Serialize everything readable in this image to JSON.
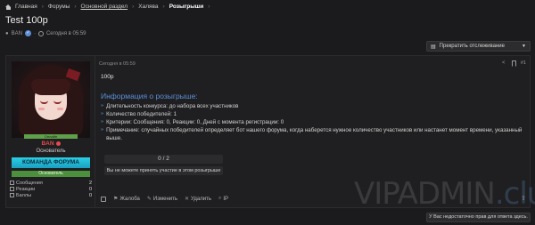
{
  "breadcrumb": {
    "items": [
      "Главная",
      "Форумы",
      "Основной раздел",
      "Халява",
      "Розыгрыши"
    ]
  },
  "thread": {
    "title": "Test 100р",
    "author": "BAN",
    "time": "Сегодня в 05:59"
  },
  "follow_button": {
    "label": "Прекратить отслеживание"
  },
  "user": {
    "name": "BAN",
    "status_bar": "Онлайн",
    "role": "Основатель",
    "banner": "КОМАНДА ФОРУМА",
    "badge": "Основатель",
    "stats": [
      {
        "label": "Сообщения",
        "value": "2"
      },
      {
        "label": "Реакции",
        "value": "0"
      },
      {
        "label": "Баллы",
        "value": "0"
      }
    ]
  },
  "post": {
    "time": "Сегодня в 05:59",
    "number": "#1",
    "message": "100р",
    "info_heading": "Информация о розыгрыше:",
    "info_items": [
      "Длительность конкурса: до набора всех участников",
      "Количество победителей: 1",
      "Критерии: Сообщения: 0, Реакции: 0, Дней с момента регистрации: 0",
      "Примечание: случайных победителей определяет бот нашего форума, когда наберется нужное количество участников или настанет момент времени, указанный выше."
    ],
    "progress_text": "0 / 2",
    "progress_fraction": 0,
    "cannot_join": "Вы не можете принять участие в этом розыгрыше",
    "actions": {
      "report": "Жалоба",
      "edit": "Изменить",
      "delete": "Удалить",
      "ip": "IP"
    }
  },
  "watermark": {
    "main": "VIPADMIN",
    "suffix": ".club"
  },
  "no_reply": "У Вас недостаточно прав для ответа здесь."
}
